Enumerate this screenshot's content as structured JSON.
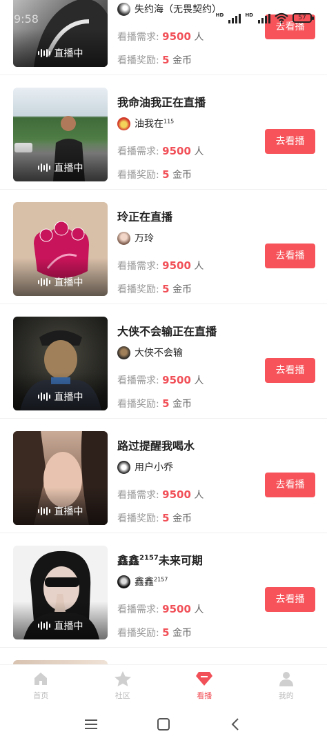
{
  "status_bar": {
    "time": "9:58",
    "battery": "57"
  },
  "common": {
    "live_label": "直播中",
    "demand_label": "看播需求:",
    "demand_value": "9500",
    "demand_unit": "人",
    "reward_label": "看播奖励:",
    "reward_value": "5",
    "reward_unit": "金币",
    "watch_button": "去看播"
  },
  "cards": [
    {
      "title": "",
      "user": "失约海（无畏契约）",
      "user_sup": ""
    },
    {
      "title": "我命油我正在直播",
      "user": "油我在",
      "user_sup": "115"
    },
    {
      "title": "玲正在直播",
      "user": "万玲",
      "user_sup": ""
    },
    {
      "title": "大侠不会输正在直播",
      "user": "大侠不会输",
      "user_sup": ""
    },
    {
      "title": "路过提醒我喝水",
      "user": "用户小乔",
      "user_sup": ""
    },
    {
      "title_main": "鑫鑫",
      "title_sup": "2157",
      "title_rest": "未来可期",
      "user": "鑫鑫",
      "user_sup": "2157"
    }
  ],
  "tabs": [
    {
      "label": "首页",
      "icon": "home-icon"
    },
    {
      "label": "社区",
      "icon": "star-icon"
    },
    {
      "label": "看播",
      "icon": "diamond-icon",
      "active": true
    },
    {
      "label": "我的",
      "icon": "person-icon"
    }
  ],
  "colors": {
    "accent": "#f6545a",
    "red_text": "#f15058"
  }
}
